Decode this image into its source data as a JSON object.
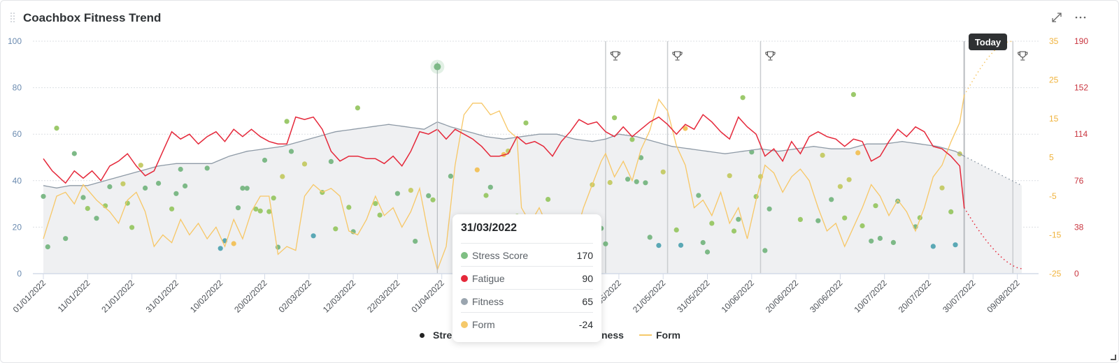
{
  "header": {
    "title": "Coachbox Fitness Trend",
    "expand_icon": "expand-arrows-icon",
    "menu_icon": "more-horizontal-icon"
  },
  "today_label": "Today",
  "tooltip": {
    "date": "31/03/2022",
    "rows": [
      {
        "label": "Stress Score",
        "value": "170",
        "color": "#7fbf83"
      },
      {
        "label": "Fatigue",
        "value": "90",
        "color": "#e5283a"
      },
      {
        "label": "Fitness",
        "value": "65",
        "color": "#9aa5af"
      },
      {
        "label": "Form",
        "value": "-24",
        "color": "#f5c96a"
      }
    ]
  },
  "legend": [
    {
      "label": "Stre",
      "marker": "dot",
      "color": "#222222"
    },
    {
      "label": "ness",
      "marker": "none",
      "color": "#222222"
    },
    {
      "label": "Form",
      "marker": "line",
      "color": "#f5c96a"
    }
  ],
  "colors": {
    "fatigue": "#e5283a",
    "fitness": "#8e9aa6",
    "fitness_fill": "#eff0f2",
    "form": "#f7c766",
    "stress_palette": [
      "#7db987",
      "#9cc96b",
      "#c6cc6b",
      "#5aa8b5",
      "#f2c35f",
      "#f0a733"
    ],
    "highlight": "#7db987"
  },
  "chart_data": {
    "type": "line",
    "title": "Coachbox Fitness Trend",
    "x_tick_labels": [
      "01/01/2022",
      "11/01/2022",
      "21/01/2022",
      "31/01/2022",
      "10/02/2022",
      "20/02/2022",
      "02/03/2022",
      "12/03/2022",
      "22/03/2022",
      "01/04/2022",
      "11/05/2022",
      "21/05/2022",
      "31/05/2022",
      "10/06/2022",
      "20/06/2022",
      "30/06/2022",
      "10/07/2022",
      "20/07/2022",
      "30/07/2022",
      "09/08/2022"
    ],
    "x_tick_day_index": [
      0,
      10,
      20,
      30,
      40,
      50,
      60,
      70,
      80,
      90,
      130,
      140,
      150,
      160,
      170,
      180,
      190,
      200,
      210,
      220
    ],
    "x_range_days": [
      0,
      221
    ],
    "today_day_index": 208,
    "event_day_index": [
      127,
      141,
      162,
      219
    ],
    "event_icon": "trophy-icon",
    "axes": {
      "left": {
        "label": "Stress Score",
        "ticks": [
          0,
          20,
          40,
          60,
          80,
          100
        ],
        "range": [
          0,
          100
        ]
      },
      "right_form": {
        "label": "Form",
        "ticks": [
          -25,
          -15,
          -5,
          5,
          15,
          25,
          35
        ],
        "range": [
          -25,
          35
        ]
      },
      "right_fatigue": {
        "label": "Fatigue",
        "ticks": [
          0,
          38,
          76,
          114,
          152,
          190
        ],
        "range": [
          0,
          190
        ]
      }
    },
    "highlight": {
      "day_index": 89,
      "date": "31/03/2022",
      "stress_score": 170,
      "fatigue": 90,
      "fitness": 65,
      "form": -24
    },
    "series": [
      {
        "name": "Fatigue",
        "axis": "right_fatigue",
        "style": "line",
        "keyframes": [
          [
            0,
            94
          ],
          [
            2,
            84
          ],
          [
            5,
            74
          ],
          [
            7,
            84
          ],
          [
            9,
            78
          ],
          [
            11,
            84
          ],
          [
            13,
            76
          ],
          [
            15,
            88
          ],
          [
            17,
            92
          ],
          [
            19,
            98
          ],
          [
            21,
            88
          ],
          [
            23,
            80
          ],
          [
            25,
            84
          ],
          [
            27,
            100
          ],
          [
            29,
            116
          ],
          [
            31,
            110
          ],
          [
            33,
            114
          ],
          [
            35,
            106
          ],
          [
            37,
            112
          ],
          [
            39,
            116
          ],
          [
            41,
            108
          ],
          [
            43,
            118
          ],
          [
            45,
            112
          ],
          [
            47,
            118
          ],
          [
            49,
            112
          ],
          [
            51,
            108
          ],
          [
            53,
            106
          ],
          [
            55,
            106
          ],
          [
            57,
            128
          ],
          [
            59,
            126
          ],
          [
            61,
            128
          ],
          [
            63,
            118
          ],
          [
            65,
            100
          ],
          [
            67,
            92
          ],
          [
            69,
            96
          ],
          [
            71,
            96
          ],
          [
            73,
            94
          ],
          [
            75,
            94
          ],
          [
            77,
            90
          ],
          [
            79,
            96
          ],
          [
            81,
            88
          ],
          [
            83,
            100
          ],
          [
            85,
            116
          ],
          [
            87,
            114
          ],
          [
            89,
            118
          ],
          [
            91,
            110
          ],
          [
            93,
            118
          ],
          [
            95,
            114
          ],
          [
            97,
            110
          ],
          [
            99,
            104
          ],
          [
            101,
            96
          ],
          [
            103,
            96
          ],
          [
            105,
            98
          ],
          [
            107,
            112
          ],
          [
            109,
            106
          ],
          [
            111,
            108
          ],
          [
            113,
            104
          ],
          [
            115,
            96
          ],
          [
            117,
            108
          ],
          [
            119,
            116
          ],
          [
            121,
            126
          ],
          [
            123,
            122
          ],
          [
            125,
            124
          ],
          [
            127,
            116
          ],
          [
            129,
            112
          ],
          [
            131,
            120
          ],
          [
            133,
            112
          ],
          [
            135,
            118
          ],
          [
            137,
            124
          ],
          [
            139,
            128
          ],
          [
            141,
            122
          ],
          [
            143,
            114
          ],
          [
            145,
            122
          ],
          [
            147,
            118
          ],
          [
            149,
            130
          ],
          [
            151,
            124
          ],
          [
            153,
            116
          ],
          [
            155,
            110
          ],
          [
            157,
            128
          ],
          [
            159,
            120
          ],
          [
            161,
            114
          ],
          [
            163,
            96
          ],
          [
            165,
            102
          ],
          [
            167,
            92
          ],
          [
            169,
            108
          ],
          [
            171,
            98
          ],
          [
            173,
            112
          ],
          [
            175,
            116
          ],
          [
            177,
            112
          ],
          [
            179,
            110
          ],
          [
            181,
            104
          ],
          [
            183,
            110
          ],
          [
            185,
            108
          ],
          [
            187,
            92
          ],
          [
            189,
            96
          ],
          [
            191,
            108
          ],
          [
            193,
            118
          ],
          [
            195,
            112
          ],
          [
            197,
            120
          ],
          [
            199,
            116
          ],
          [
            201,
            104
          ],
          [
            203,
            102
          ],
          [
            205,
            96
          ],
          [
            207,
            88
          ],
          [
            208,
            54
          ]
        ],
        "keyframes_desc": "downsampled from visible curve"
      },
      {
        "name": "Fitness",
        "axis": "right_fatigue",
        "style": "area",
        "values_desc": "smooth curve",
        "keyframes": [
          [
            0,
            72
          ],
          [
            3,
            70
          ],
          [
            6,
            72
          ],
          [
            10,
            72
          ],
          [
            14,
            76
          ],
          [
            18,
            80
          ],
          [
            22,
            84
          ],
          [
            26,
            88
          ],
          [
            30,
            90
          ],
          [
            34,
            90
          ],
          [
            38,
            90
          ],
          [
            42,
            96
          ],
          [
            46,
            100
          ],
          [
            50,
            102
          ],
          [
            54,
            104
          ],
          [
            58,
            108
          ],
          [
            62,
            112
          ],
          [
            66,
            116
          ],
          [
            70,
            118
          ],
          [
            74,
            120
          ],
          [
            78,
            122
          ],
          [
            82,
            120
          ],
          [
            86,
            118
          ],
          [
            89,
            124
          ],
          [
            92,
            120
          ],
          [
            96,
            116
          ],
          [
            100,
            112
          ],
          [
            104,
            110
          ],
          [
            108,
            112
          ],
          [
            112,
            114
          ],
          [
            116,
            114
          ],
          [
            120,
            110
          ],
          [
            124,
            108
          ],
          [
            127,
            110
          ],
          [
            130,
            114
          ],
          [
            134,
            112
          ],
          [
            138,
            108
          ],
          [
            142,
            104
          ],
          [
            146,
            102
          ],
          [
            150,
            100
          ],
          [
            154,
            98
          ],
          [
            158,
            100
          ],
          [
            162,
            102
          ],
          [
            166,
            100
          ],
          [
            170,
            102
          ],
          [
            174,
            104
          ],
          [
            178,
            102
          ],
          [
            182,
            102
          ],
          [
            186,
            106
          ],
          [
            190,
            106
          ],
          [
            194,
            108
          ],
          [
            198,
            106
          ],
          [
            202,
            104
          ],
          [
            206,
            100
          ],
          [
            208,
            96
          ]
        ]
      },
      {
        "name": "Form",
        "axis": "right_form",
        "style": "line",
        "keyframes": [
          [
            0,
            -16
          ],
          [
            3,
            -5
          ],
          [
            5,
            -4
          ],
          [
            7,
            -7
          ],
          [
            9,
            -2
          ],
          [
            12,
            -6
          ],
          [
            15,
            -9
          ],
          [
            17,
            -12
          ],
          [
            19,
            -6
          ],
          [
            21,
            -4
          ],
          [
            23,
            -9
          ],
          [
            25,
            -18
          ],
          [
            27,
            -15
          ],
          [
            29,
            -17
          ],
          [
            31,
            -11
          ],
          [
            33,
            -15
          ],
          [
            35,
            -12
          ],
          [
            37,
            -16
          ],
          [
            39,
            -13
          ],
          [
            41,
            -18
          ],
          [
            43,
            -11
          ],
          [
            45,
            -16
          ],
          [
            47,
            -9
          ],
          [
            49,
            -5
          ],
          [
            51,
            -5
          ],
          [
            53,
            -20
          ],
          [
            55,
            -18
          ],
          [
            57,
            -19
          ],
          [
            59,
            -5
          ],
          [
            61,
            -2
          ],
          [
            63,
            -4
          ],
          [
            65,
            -3
          ],
          [
            67,
            -5
          ],
          [
            69,
            -14
          ],
          [
            71,
            -15
          ],
          [
            73,
            -11
          ],
          [
            75,
            -5
          ],
          [
            77,
            -10
          ],
          [
            79,
            -8
          ],
          [
            81,
            -13
          ],
          [
            83,
            -9
          ],
          [
            85,
            -3
          ],
          [
            87,
            -15
          ],
          [
            89,
            -24
          ],
          [
            91,
            -18
          ],
          [
            93,
            3
          ],
          [
            95,
            16
          ],
          [
            97,
            19
          ],
          [
            99,
            19
          ],
          [
            101,
            16
          ],
          [
            103,
            17
          ],
          [
            105,
            12
          ],
          [
            107,
            10
          ],
          [
            108,
            -8
          ],
          [
            110,
            -12
          ],
          [
            112,
            -8
          ],
          [
            114,
            -13
          ],
          [
            116,
            -16
          ],
          [
            118,
            -12
          ],
          [
            120,
            -16
          ],
          [
            122,
            -8
          ],
          [
            124,
            -2
          ],
          [
            126,
            4
          ],
          [
            127,
            6
          ],
          [
            129,
            0
          ],
          [
            131,
            4
          ],
          [
            133,
            -1
          ],
          [
            135,
            7
          ],
          [
            137,
            12
          ],
          [
            139,
            20
          ],
          [
            141,
            17
          ],
          [
            143,
            8
          ],
          [
            145,
            3
          ],
          [
            147,
            -8
          ],
          [
            149,
            -6
          ],
          [
            151,
            -10
          ],
          [
            153,
            -4
          ],
          [
            155,
            -12
          ],
          [
            157,
            -8
          ],
          [
            159,
            -16
          ],
          [
            161,
            -6
          ],
          [
            163,
            3
          ],
          [
            165,
            1
          ],
          [
            167,
            -4
          ],
          [
            169,
            0
          ],
          [
            171,
            2
          ],
          [
            173,
            -1
          ],
          [
            175,
            -8
          ],
          [
            177,
            -14
          ],
          [
            179,
            -12
          ],
          [
            181,
            -18
          ],
          [
            183,
            -13
          ],
          [
            185,
            -8
          ],
          [
            187,
            -2
          ],
          [
            189,
            -5
          ],
          [
            191,
            -10
          ],
          [
            193,
            -6
          ],
          [
            195,
            -9
          ],
          [
            197,
            -14
          ],
          [
            199,
            -8
          ],
          [
            201,
            0
          ],
          [
            203,
            3
          ],
          [
            205,
            9
          ],
          [
            207,
            14
          ],
          [
            208,
            21
          ]
        ]
      },
      {
        "name": "Stress Score",
        "axis": "left",
        "style": "scatter",
        "values_desc": "daily dots, colored by intensity"
      }
    ],
    "projection": {
      "style": "dotted",
      "from_day_index": 208,
      "fatigue_end": 4,
      "fitness_end": 72,
      "form_peak": 35
    }
  }
}
